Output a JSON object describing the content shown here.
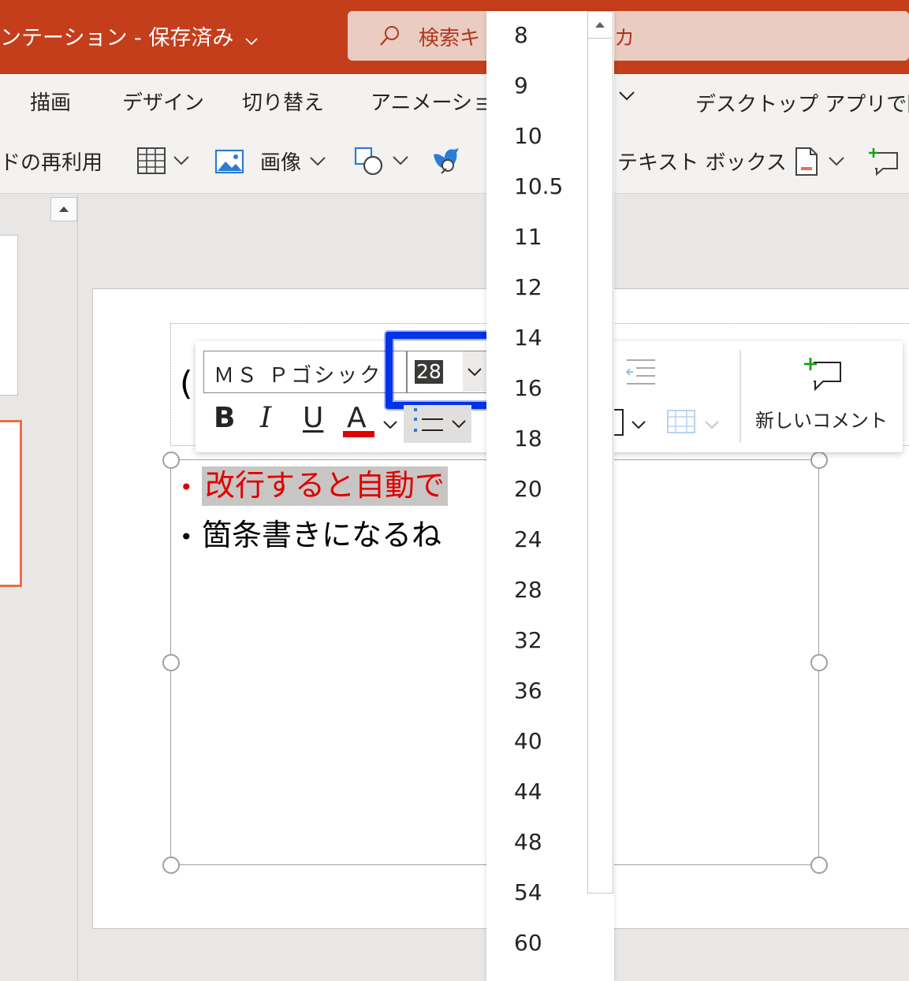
{
  "titlebar": {
    "doc_title": "ンテーション - 保存済み",
    "search_left": "検索キ",
    "search_right": "カ"
  },
  "ribbon": {
    "tabs": [
      "描画",
      "デザイン",
      "切り替え",
      "アニメーション"
    ],
    "open_desktop": "デスクトップ アプリで開く",
    "reuse_slides": "ドの再利用",
    "image_label": "画像",
    "textbox_label": "テキスト ボックス"
  },
  "slide": {
    "title_fragment": "(",
    "bullets": [
      "改行すると自動で",
      "箇条書きになるね"
    ],
    "bullet_char": "•"
  },
  "minibar": {
    "font_name": "ＭＳ Ｐゴシック",
    "font_size": "28",
    "bold": "B",
    "italic": "I",
    "underline": "U",
    "font_color": "A",
    "new_comment": "新しいコメント"
  },
  "font_size_dropdown": {
    "options": [
      "8",
      "9",
      "10",
      "10.5",
      "11",
      "12",
      "14",
      "16",
      "18",
      "20",
      "24",
      "28",
      "32",
      "36",
      "40",
      "44",
      "48",
      "54",
      "60"
    ]
  },
  "colors": {
    "titlebar": "#c43e1c",
    "accent_red": "#e00000",
    "highlight_blue": "#0032e8",
    "selected_thumb": "#e8704d"
  }
}
